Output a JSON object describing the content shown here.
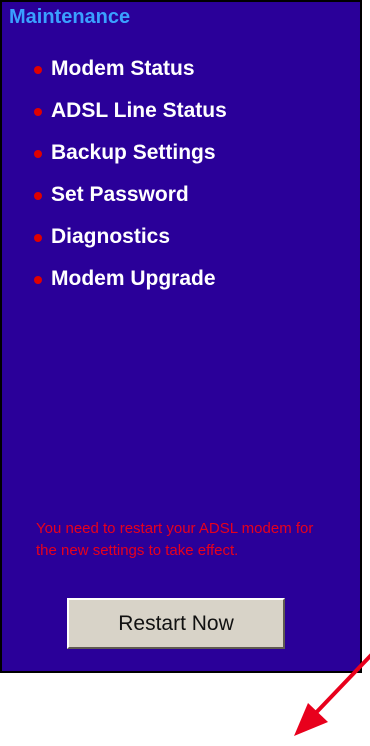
{
  "panel": {
    "section_title": "Maintenance",
    "menu": [
      {
        "label": "Modem Status"
      },
      {
        "label": "ADSL Line Status"
      },
      {
        "label": "Backup Settings"
      },
      {
        "label": "Set Password"
      },
      {
        "label": "Diagnostics"
      },
      {
        "label": "Modem Upgrade"
      }
    ],
    "notice": "You need to restart your ADSL modem for the new settings to take effect.",
    "restart_button": "Restart Now"
  },
  "colors": {
    "panel_background": "#2a0099",
    "section_title": "#3aa0ff",
    "menu_text": "#ffffff",
    "bullet": "#e00000",
    "notice_text": "#e8001c",
    "button_face": "#d8d3c8",
    "annotation_arrow": "#e8001c"
  },
  "icons": {
    "bullet": "red-dot-bullet-icon",
    "annotation": "red-arrow-icon"
  }
}
